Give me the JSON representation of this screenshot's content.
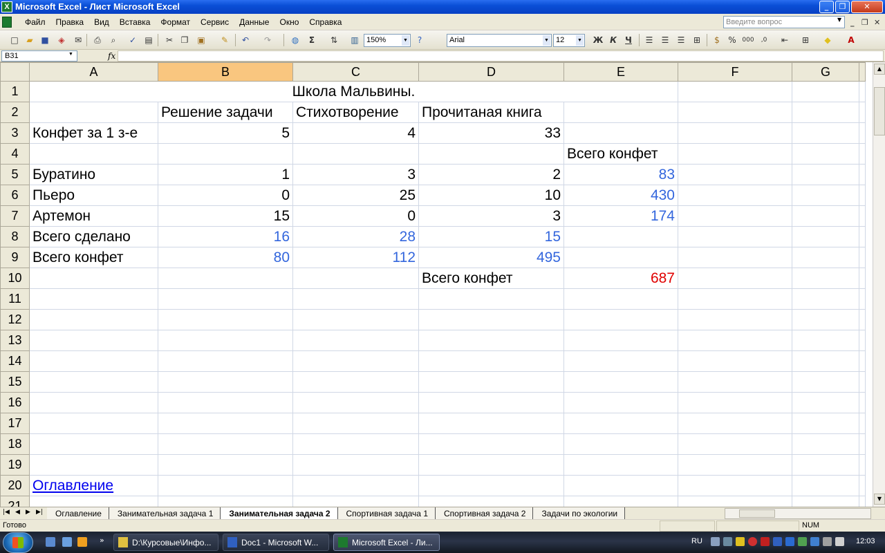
{
  "window": {
    "title": "Microsoft Excel - Лист Microsoft Excel",
    "app_icon": "X"
  },
  "menubar": {
    "items": [
      "Файл",
      "Правка",
      "Вид",
      "Вставка",
      "Формат",
      "Сервис",
      "Данные",
      "Окно",
      "Справка"
    ],
    "help_placeholder": "Введите вопрос"
  },
  "toolbar": {
    "zoom": "150%",
    "font": "Arial",
    "font_size": "12"
  },
  "formula_bar": {
    "name_box": "B31",
    "fx": "fx",
    "formula": ""
  },
  "sheet": {
    "columns": [
      "A",
      "B",
      "C",
      "D",
      "E",
      "F",
      "G"
    ],
    "selected_column": "B",
    "rows": [
      {
        "n": "1",
        "a": "",
        "b": "",
        "c": "Школа Мальвины.",
        "d": "",
        "e": "",
        "f": "",
        "g": ""
      },
      {
        "n": "2",
        "a": "",
        "b": "Решение задачи",
        "c": "Стихотворение",
        "d": "Прочитаная книга",
        "e": "",
        "f": "",
        "g": ""
      },
      {
        "n": "3",
        "a": "Конфет за 1 з-е",
        "b": "5",
        "c": "4",
        "d": "33",
        "e": "",
        "f": "",
        "g": ""
      },
      {
        "n": "4",
        "a": "",
        "b": "",
        "c": "",
        "d": "",
        "e": "Всего конфет",
        "f": "",
        "g": ""
      },
      {
        "n": "5",
        "a": "Буратино",
        "b": "1",
        "c": "3",
        "d": "2",
        "e": "83",
        "f": "",
        "g": ""
      },
      {
        "n": "6",
        "a": "Пьеро",
        "b": "0",
        "c": "25",
        "d": "10",
        "e": "430",
        "f": "",
        "g": ""
      },
      {
        "n": "7",
        "a": "Артемон",
        "b": "15",
        "c": "0",
        "d": "3",
        "e": "174",
        "f": "",
        "g": ""
      },
      {
        "n": "8",
        "a": "Всего сделано",
        "b": "16",
        "c": "28",
        "d": "15",
        "e": "",
        "f": "",
        "g": ""
      },
      {
        "n": "9",
        "a": "Всего конфет",
        "b": "80",
        "c": "112",
        "d": "495",
        "e": "",
        "f": "",
        "g": ""
      },
      {
        "n": "10",
        "a": "",
        "b": "",
        "c": "",
        "d": "Всего конфет",
        "e": "687",
        "f": "",
        "g": ""
      },
      {
        "n": "11"
      },
      {
        "n": "12"
      },
      {
        "n": "13"
      },
      {
        "n": "14"
      },
      {
        "n": "15"
      },
      {
        "n": "16"
      },
      {
        "n": "17"
      },
      {
        "n": "18"
      },
      {
        "n": "19"
      },
      {
        "n": "20",
        "a": "Оглавление"
      },
      {
        "n": "21"
      }
    ]
  },
  "sheet_tabs": {
    "tabs": [
      "Оглавление",
      "Занимательная задача 1",
      "Занимательная задача 2",
      "Спортивная задача 1",
      "Спортивная задача 2",
      "Задачи по экологии"
    ],
    "active": "Занимательная задача 2"
  },
  "status": {
    "text": "Готово",
    "num": "NUM"
  },
  "taskbar": {
    "buttons": [
      "D:\\Курсовые\\Инфо...",
      "Doc1 - Microsoft W...",
      "Microsoft Excel - Ли..."
    ],
    "lang": "RU",
    "clock": "12:03"
  },
  "colors": {
    "value_blue": "#3366dd",
    "total_red": "#e00000",
    "selected_header": "#f9c67f"
  }
}
